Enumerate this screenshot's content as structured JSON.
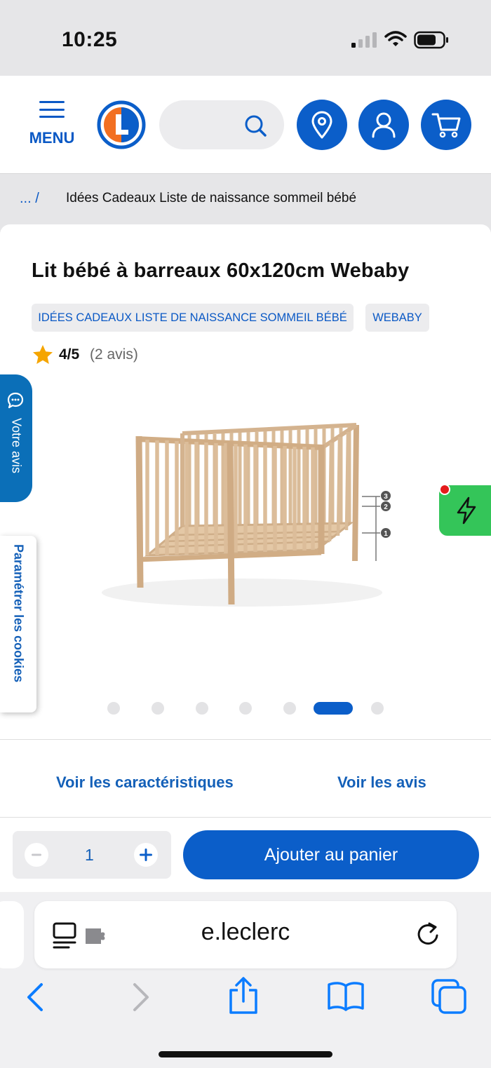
{
  "status_bar": {
    "time": "10:25"
  },
  "header": {
    "menu_label": "MENU",
    "logo_letter": "L"
  },
  "breadcrumb": {
    "ellipsis": "... /",
    "current": "Idées Cadeaux Liste de naissance sommeil bébé"
  },
  "product": {
    "title": "Lit bébé à barreaux 60x120cm Webaby",
    "tags": [
      "IDÉES CADEAUX LISTE DE NAISSANCE SOMMEIL BÉBÉ",
      "WEBABY"
    ],
    "rating": {
      "score": "4/5",
      "count": "(2 avis)"
    },
    "height_markers": [
      "3",
      "2",
      "1"
    ]
  },
  "side_tabs": {
    "feedback": "Votre avis",
    "cookies": "Paramétrer les cookies"
  },
  "carousel": {
    "total": 7,
    "active_index": 5
  },
  "links": {
    "features": "Voir les caractéristiques",
    "reviews": "Voir les avis"
  },
  "purchase": {
    "quantity": "1",
    "add_to_cart": "Ajouter au panier"
  },
  "browser": {
    "url": "e.leclerc"
  },
  "colors": {
    "brand_blue": "#0b5ec9",
    "flash_green": "#34c559",
    "alert_red": "#e41b1b"
  }
}
